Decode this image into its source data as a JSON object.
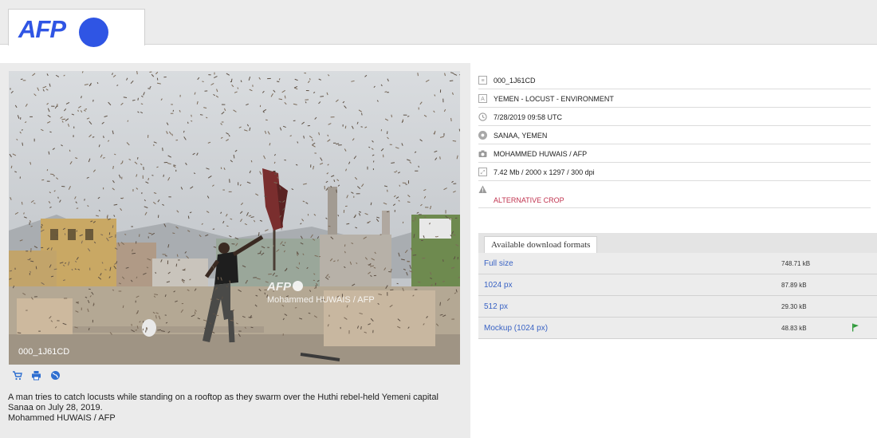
{
  "header": {
    "logo_text": "AFP",
    "brand_color": "#2f55e4"
  },
  "photo": {
    "id_overlay": "000_1J61CD",
    "watermark_logo": "AFP",
    "watermark_credit": "Mohammed HUWAIS / AFP"
  },
  "tools": [
    {
      "icon": "cart-icon"
    },
    {
      "icon": "print-icon"
    },
    {
      "icon": "globe-icon"
    }
  ],
  "caption": {
    "text": "A man tries to catch locusts while standing on a rooftop as they swarm over the Huthi rebel-held Yemeni capital Sanaa on July 28, 2019.",
    "credit": "Mohammed HUWAIS / AFP"
  },
  "meta": {
    "id": "000_1J61CD",
    "title": "YEMEN - LOCUST - ENVIRONMENT",
    "datetime": "7/28/2019 09:58 UTC",
    "location": "SANAA, YEMEN",
    "photographer": "MOHAMMED HUWAIS / AFP",
    "file_info": "7.42 Mb / 2000 x 1297 / 300 dpi",
    "warning": "ALTERNATIVE CROP",
    "warning_color": "#c0334f"
  },
  "downloads": {
    "tab_label": "Available download formats",
    "rows": [
      {
        "name": "Full size",
        "size": "748.71 kB"
      },
      {
        "name": "1024 px",
        "size": "87.89 kB"
      },
      {
        "name": "512 px",
        "size": "29.30 kB"
      },
      {
        "name": "Mockup (1024 px)",
        "size": "48.83 kB",
        "flag": "flag-icon"
      }
    ]
  }
}
